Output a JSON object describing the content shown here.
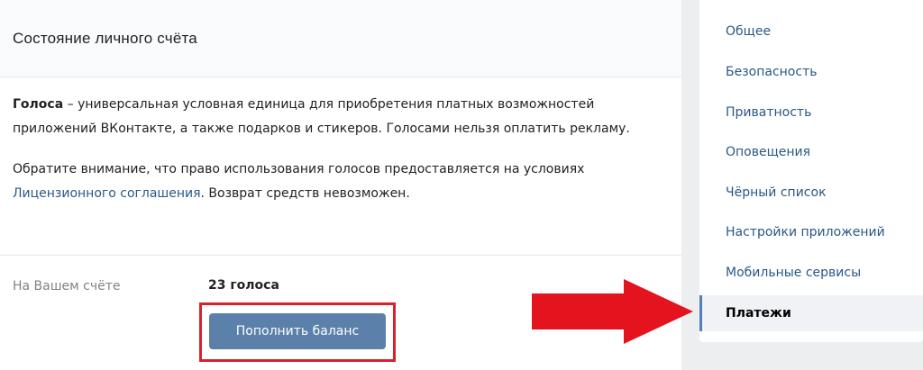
{
  "main": {
    "title": "Состояние личного счёта",
    "info": {
      "term": "Голоса",
      "intro": " – универсальная условная единица для приобретения платных возможностей приложений ВКонтакте, а также подарков и стикеров. Голосами нельзя оплатить рекламу.",
      "notice_before_link": "Обратите внимание, что право использования голосов предоставляется на условиях ",
      "license_link": "Лицензионного соглашения",
      "notice_after_link": ". Возврат средств невозможен."
    },
    "balance": {
      "label": "На Вашем счёте",
      "value": "23 голоса"
    },
    "topup_button": "Пополнить баланс"
  },
  "sidebar": {
    "items": [
      {
        "label": "Общее"
      },
      {
        "label": "Безопасность"
      },
      {
        "label": "Приватность"
      },
      {
        "label": "Оповещения"
      },
      {
        "label": "Чёрный список"
      },
      {
        "label": "Настройки приложений"
      },
      {
        "label": "Мобильные сервисы"
      },
      {
        "label": "Платежи"
      }
    ],
    "active_index": 7
  },
  "colors": {
    "highlight": "#d9202d",
    "button": "#5b81ab",
    "link": "#2a5885",
    "arrow": "#e3141e"
  }
}
